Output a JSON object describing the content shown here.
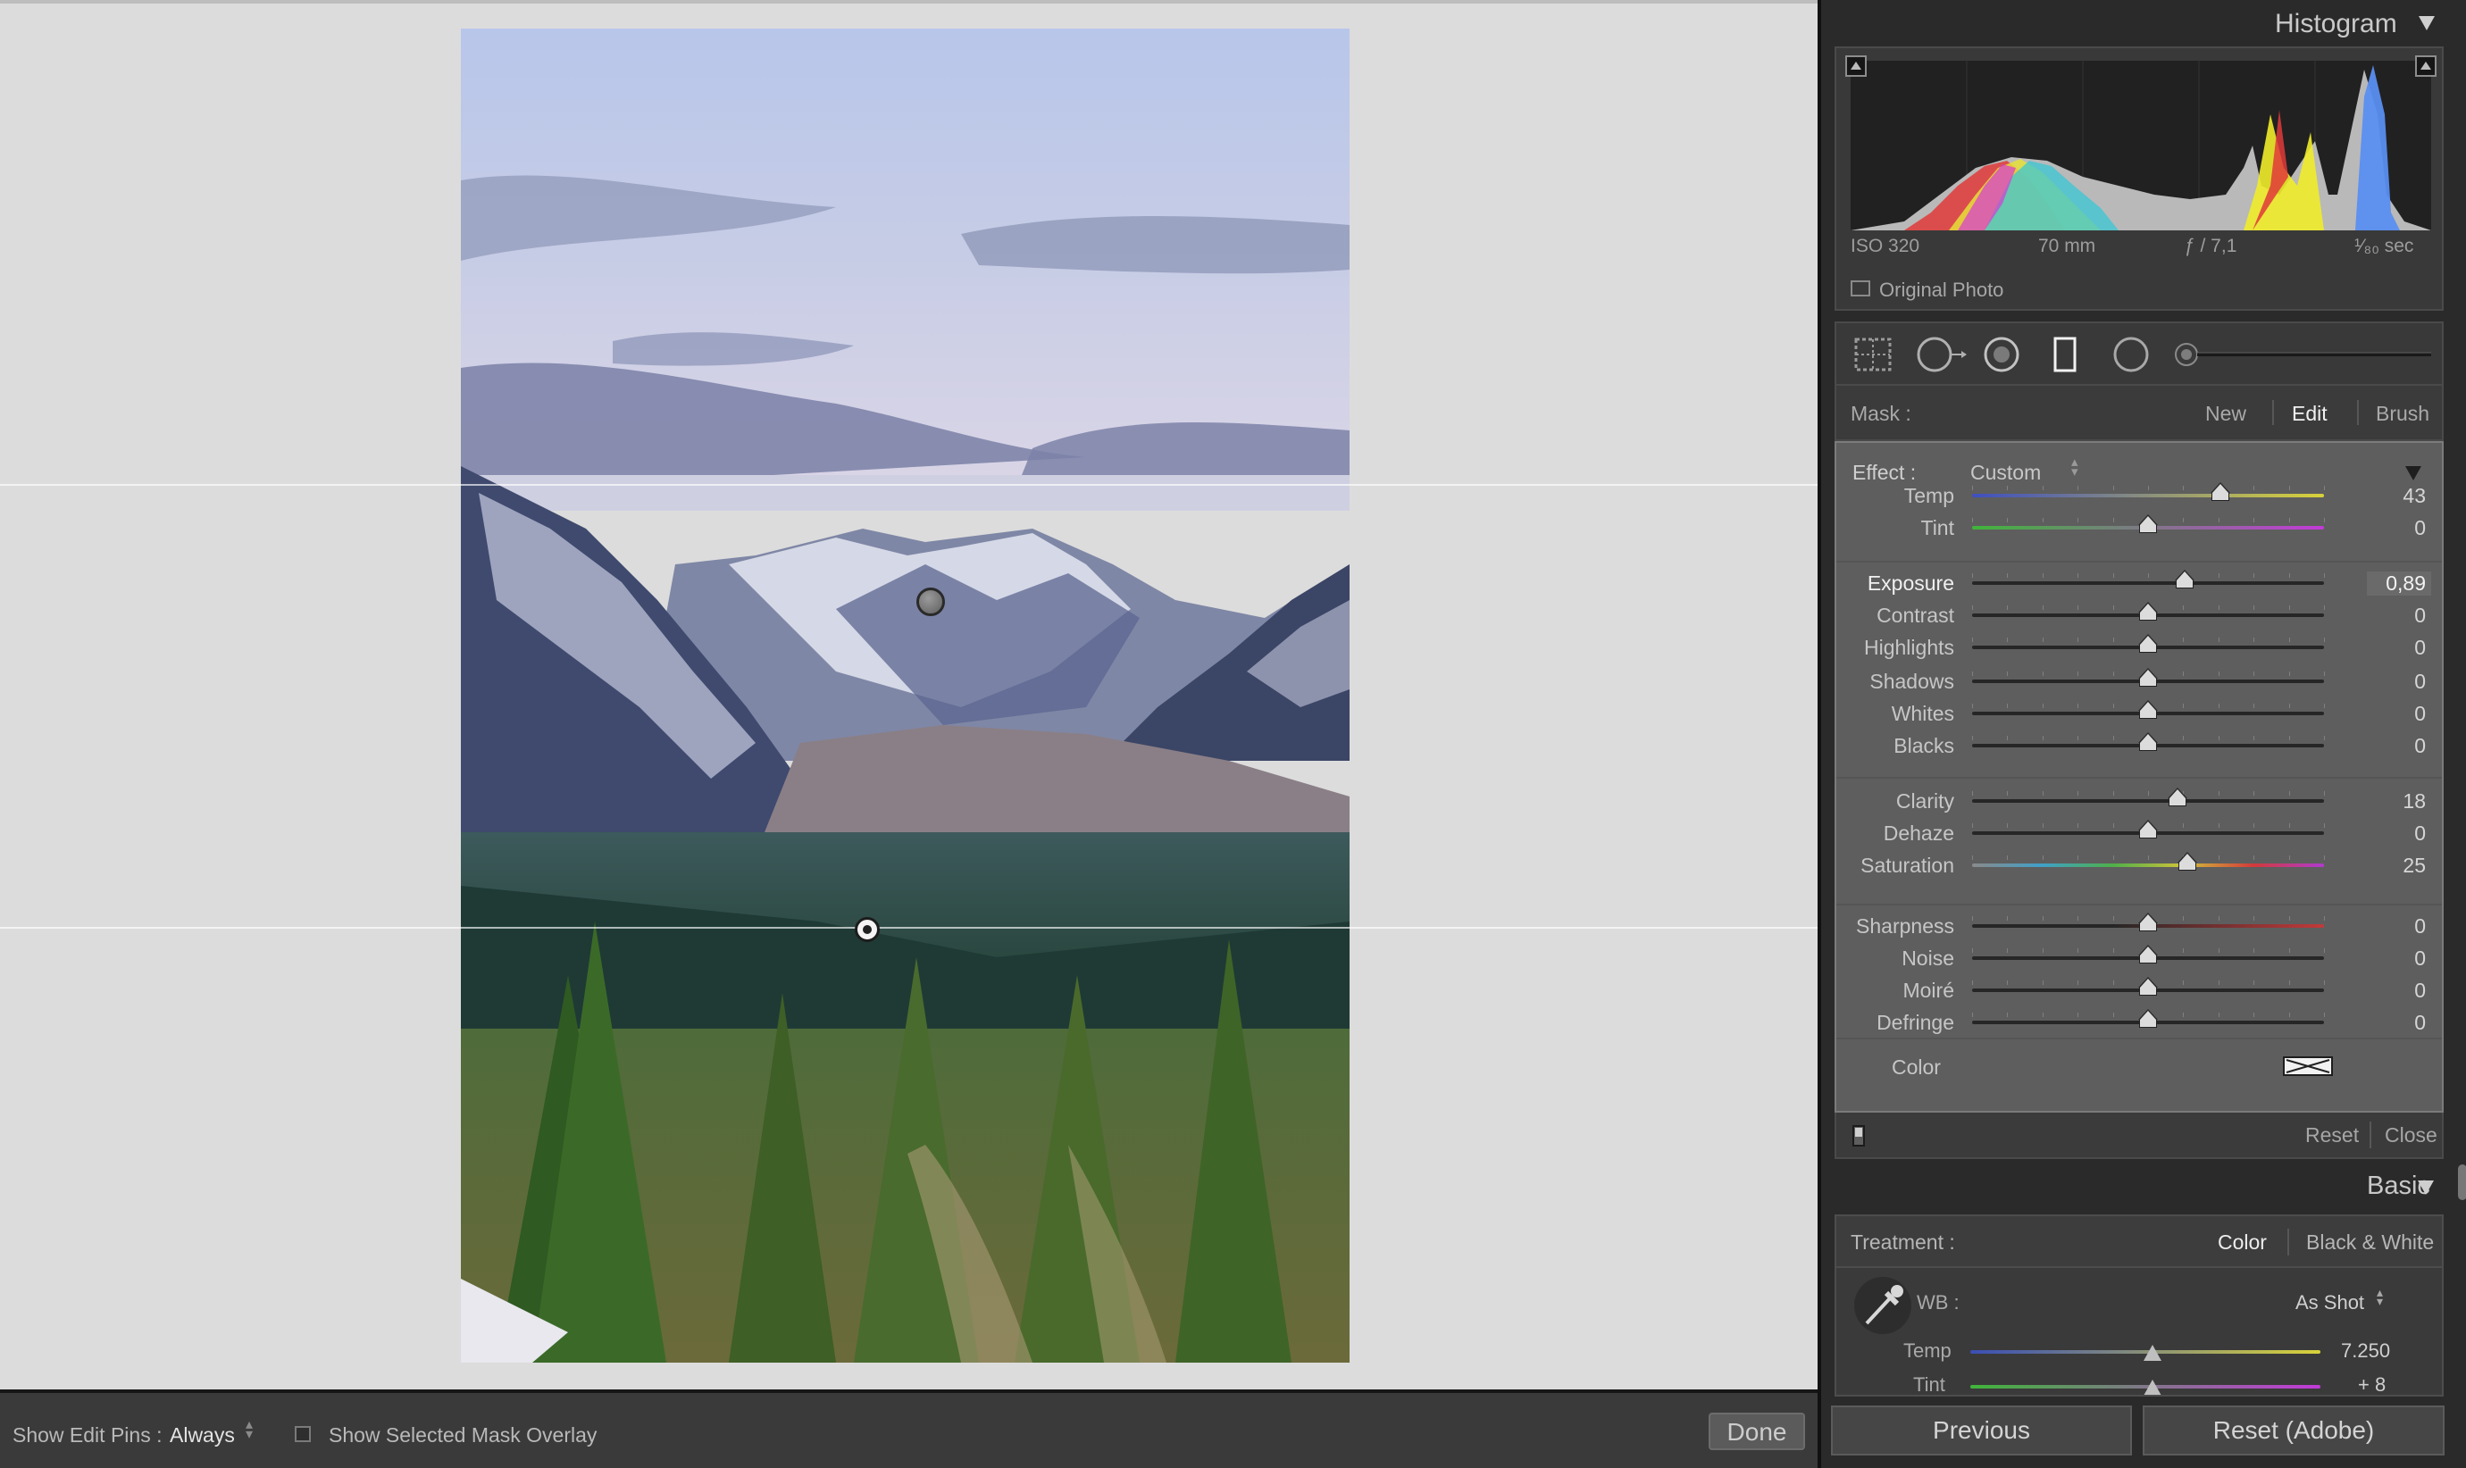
{
  "toolbar": {
    "show_edit_pins_label": "Show Edit Pins :",
    "show_edit_pins_value": "Always",
    "mask_overlay_label": "Show Selected Mask Overlay",
    "done_label": "Done"
  },
  "histogram": {
    "title": "Histogram",
    "iso": "ISO 320",
    "focal": "70 mm",
    "aperture": "ƒ / 7,1",
    "shutter": "¹⁄₈₀ sec",
    "original_photo_label": "Original Photo"
  },
  "mask": {
    "label": "Mask :",
    "new_label": "New",
    "edit_label": "Edit",
    "brush_label": "Brush"
  },
  "effect": {
    "label": "Effect :",
    "value": "Custom",
    "sliders": [
      {
        "label": "Temp",
        "value": "43",
        "pos": 0.705
      },
      {
        "label": "Tint",
        "value": "0",
        "pos": 0.5
      },
      {
        "label": "Exposure",
        "value": "0,89",
        "pos": 0.605
      },
      {
        "label": "Contrast",
        "value": "0",
        "pos": 0.5
      },
      {
        "label": "Highlights",
        "value": "0",
        "pos": 0.5
      },
      {
        "label": "Shadows",
        "value": "0",
        "pos": 0.5
      },
      {
        "label": "Whites",
        "value": "0",
        "pos": 0.5
      },
      {
        "label": "Blacks",
        "value": "0",
        "pos": 0.5
      },
      {
        "label": "Clarity",
        "value": "18",
        "pos": 0.585
      },
      {
        "label": "Dehaze",
        "value": "0",
        "pos": 0.5
      },
      {
        "label": "Saturation",
        "value": "25",
        "pos": 0.612
      },
      {
        "label": "Sharpness",
        "value": "0",
        "pos": 0.5
      },
      {
        "label": "Noise",
        "value": "0",
        "pos": 0.5
      },
      {
        "label": "Moiré",
        "value": "0",
        "pos": 0.5
      },
      {
        "label": "Defringe",
        "value": "0",
        "pos": 0.5
      }
    ],
    "color_label": "Color",
    "reset_label": "Reset",
    "close_label": "Close"
  },
  "basic": {
    "title": "Basic",
    "treatment_label": "Treatment :",
    "color_option": "Color",
    "bw_option": "Black & White",
    "wb_label": "WB :",
    "wb_value": "As Shot",
    "temp_label": "Temp",
    "temp_value": "7.250",
    "temp_pos": 0.52,
    "tint_label": "Tint",
    "tint_value": "+ 8",
    "tint_pos": 0.52
  },
  "nav": {
    "previous_label": "Previous",
    "reset_label": "Reset (Adobe)"
  },
  "colors": {
    "workspace_bg": "#dcdcdc",
    "panel_bg": "#2a2a2a",
    "effects_bg": "#5e5e5e"
  }
}
